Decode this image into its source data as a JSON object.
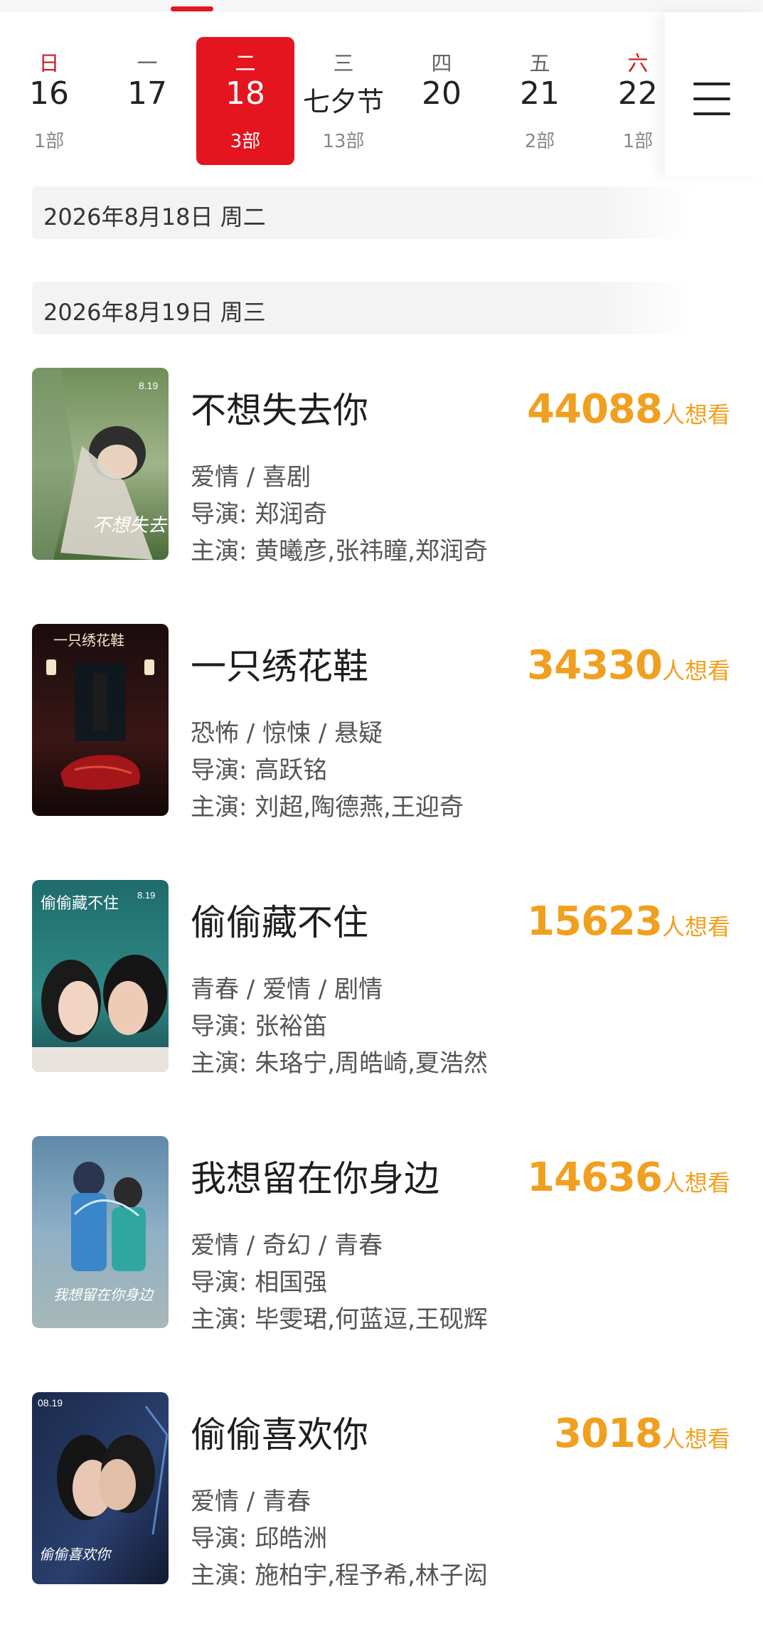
{
  "calendar": {
    "days": [
      {
        "weekday": "日",
        "date": "16",
        "count": "1部"
      },
      {
        "weekday": "一",
        "date": "17",
        "count": ""
      },
      {
        "weekday": "二",
        "date": "18",
        "count": "3部"
      },
      {
        "weekday": "三",
        "date": "七夕节",
        "count": "13部"
      },
      {
        "weekday": "四",
        "date": "20",
        "count": ""
      },
      {
        "weekday": "五",
        "date": "21",
        "count": "2部"
      },
      {
        "weekday": "六",
        "date": "22",
        "count": "1部"
      }
    ],
    "selected_date": "18"
  },
  "menu": {
    "icon": "menu-icon"
  },
  "sections": [
    {
      "date_label": "2026年8月18日 周二"
    },
    {
      "date_label": "2026年8月19日 周三"
    }
  ],
  "movies": [
    {
      "title": "不想失去你",
      "want_count": "44088",
      "want_label": "人想看",
      "genre": "爱情 / 喜剧",
      "director": "导演: 郑润奇",
      "cast": "主演: 黄曦彦,张祎瞳,郑润奇"
    },
    {
      "title": "一只绣花鞋",
      "want_count": "34330",
      "want_label": "人想看",
      "genre": "恐怖 / 惊悚 / 悬疑",
      "director": "导演: 高跃铭",
      "cast": "主演: 刘超,陶德燕,王迎奇"
    },
    {
      "title": "偷偷藏不住",
      "want_count": "15623",
      "want_label": "人想看",
      "genre": "青春 / 爱情 / 剧情",
      "director": "导演: 张裕笛",
      "cast": "主演: 朱珞宁,周皓崎,夏浩然"
    },
    {
      "title": "我想留在你身边",
      "want_count": "14636",
      "want_label": "人想看",
      "genre": "爱情 / 奇幻 / 青春",
      "director": "导演: 相国强",
      "cast": "主演: 毕雯珺,何蓝逗,王砚辉"
    },
    {
      "title": "偷偷喜欢你",
      "want_count": "3018",
      "want_label": "人想看",
      "genre": "爱情 / 青春",
      "director": "导演: 邱皓洲",
      "cast": "主演: 施柏宇,程予希,林子闳"
    }
  ],
  "colors": {
    "accent_red": "#e4151f",
    "want_orange": "#f0a020"
  }
}
